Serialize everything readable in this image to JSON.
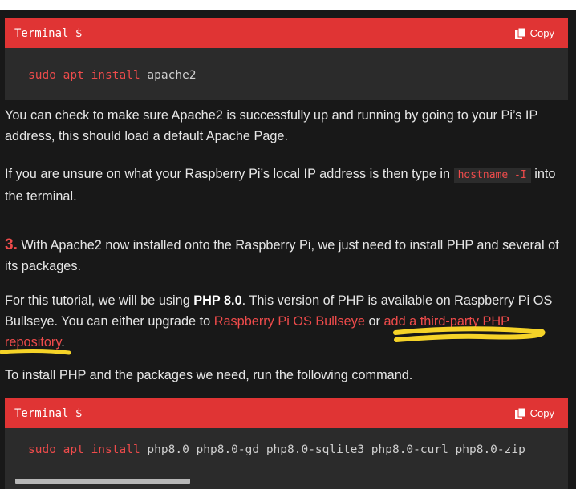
{
  "terminal1": {
    "title": "Terminal $",
    "copy_label": "Copy",
    "command_keyword": "sudo apt install",
    "command_args": "apache2"
  },
  "paragraphs": {
    "p1": "You can check to make sure Apache2 is successfully up and running by going to your Pi’s IP address, this should load a default Apache Page.",
    "p2_before": "If you are unsure on what your Raspberry Pi’s local IP address is then type in ",
    "p2_code": "hostname -I",
    "p2_after": " into the terminal.",
    "p3_number": "3.",
    "p3_text": " With Apache2 now installed onto the Raspberry Pi, we just need to install PHP and several of its packages.",
    "p4_before": "For this tutorial, we will be using ",
    "p4_bold": "PHP 8.0",
    "p4_mid": ". This version of PHP is available on Raspberry Pi OS Bullseye. You can either upgrade to ",
    "p4_link1": "Raspberry Pi OS Bullseye",
    "p4_or": " or ",
    "p4_link2": "add a third-party PHP repository",
    "p4_end": ".",
    "p5": "To install PHP and the packages we need, run the following command."
  },
  "terminal2": {
    "title": "Terminal $",
    "copy_label": "Copy",
    "command_keyword": "sudo apt install",
    "command_args": "php8.0 php8.0-gd php8.0-sqlite3 php8.0-curl php8.0-zip"
  },
  "colors": {
    "accent": "#e03434",
    "highlighter": "#f5d328",
    "background": "#181818"
  }
}
